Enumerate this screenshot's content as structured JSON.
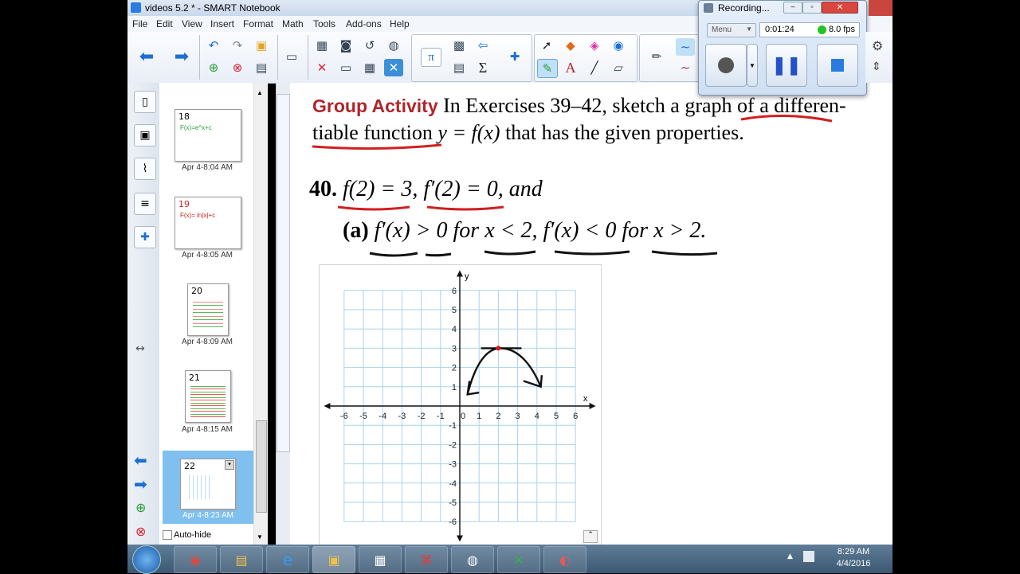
{
  "window": {
    "title": "videos 5.2 * - SMART Notebook"
  },
  "menu": [
    "File",
    "Edit",
    "View",
    "Insert",
    "Format",
    "Math",
    "Tools",
    "Add-ons",
    "Help"
  ],
  "toolbar": {
    "icons": [
      "back-arrow-icon",
      "forward-arrow-icon",
      "undo-icon",
      "redo-icon",
      "open-icon",
      "save-icon",
      "screen-shade-icon",
      "delete-icon",
      "table-icon",
      "pi-icon",
      "sigma-icon",
      "select-arrow-icon",
      "pen-icon",
      "text-icon",
      "line-icon",
      "eraser-icon",
      "shape-icon"
    ],
    "math_pi": "π",
    "math_sigma": "Σ",
    "text_tool": "A"
  },
  "sorter": {
    "pages": [
      {
        "num": "18",
        "label": "Apr 4-8:04 AM",
        "snippet": "F(x)=e^x+c"
      },
      {
        "num": "19",
        "label": "Apr 4-8:05 AM",
        "snippet": "F(x)= ln|x|+c"
      },
      {
        "num": "20",
        "label": "Apr 4-8:09 AM",
        "snippet": ""
      },
      {
        "num": "21",
        "label": "Apr 4-8:15 AM",
        "snippet": ""
      },
      {
        "num": "22",
        "label": "Apr 4-8:23 AM",
        "snippet": ""
      }
    ],
    "autohide_label": "Auto-hide"
  },
  "page": {
    "heading": "Group Activity",
    "instruction_line1": "In Exercises 39–42, sketch a graph of a differen-",
    "instruction_line2_a": "tiable function",
    "instruction_line2_b": "y = f(x)",
    "instruction_line2_c": "that has the given properties.",
    "ex_number": "40.",
    "ex_line1": "f(2) = 3,   f′(2) = 0,   and",
    "ex_part": "(a)",
    "ex_line2": "f′(x) > 0  for  x < 2,   f′(x) < 0  for  x > 2.",
    "x_axis_label": "x",
    "y_axis_label": "y",
    "x_ticks": [
      "-6",
      "-5",
      "-4",
      "-3",
      "-2",
      "-1",
      "0",
      "1",
      "2",
      "3",
      "4",
      "5",
      "6"
    ],
    "y_ticks": [
      "6",
      "5",
      "4",
      "3",
      "2",
      "1",
      "-1",
      "-2",
      "-3",
      "-4",
      "-5",
      "-6"
    ]
  },
  "recorder": {
    "title": "Recording...",
    "menu_label": "Menu",
    "time": "0:01:24",
    "fps": "8.0 fps",
    "status_color": "#22c322"
  },
  "taskbar": {
    "time": "8:29 AM",
    "date": "4/4/2016",
    "apps": [
      "start-orb-icon",
      "chrome-icon",
      "file-explorer-icon",
      "internet-explorer-icon",
      "smart-notebook-icon",
      "calculator-icon",
      "acrobat-icon",
      "network-app-icon",
      "excel-icon",
      "recorder-app-icon"
    ]
  },
  "colors": {
    "heading_red": "#b0252a",
    "annotation_red": "#d21f1f",
    "grid_blue": "#a9d2ee"
  }
}
